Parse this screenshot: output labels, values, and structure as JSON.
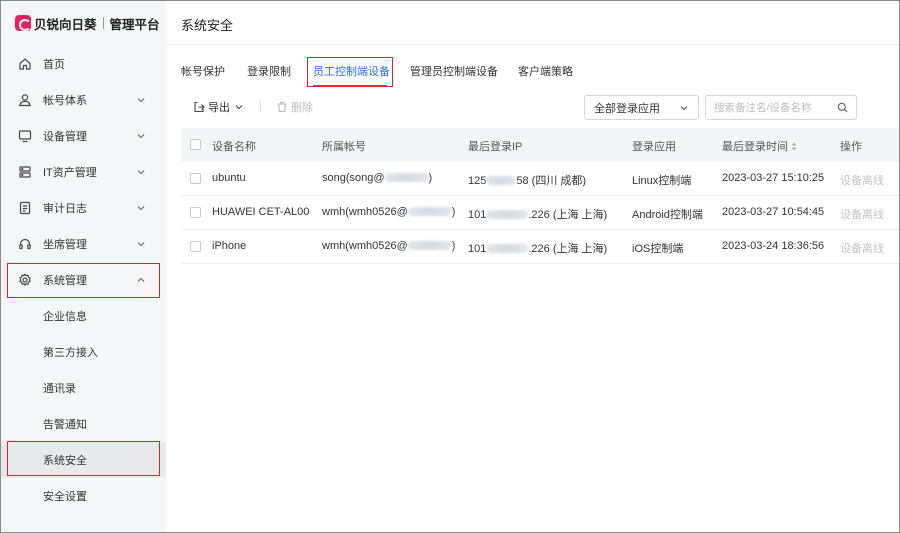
{
  "app": {
    "brand": "贝锐向日葵",
    "product": "管理平台"
  },
  "sidebar": {
    "items": [
      {
        "label": "首页",
        "icon": "home-icon"
      },
      {
        "label": "帐号体系",
        "icon": "user-icon"
      },
      {
        "label": "设备管理",
        "icon": "monitor-icon"
      },
      {
        "label": "IT资产管理",
        "icon": "server-icon"
      },
      {
        "label": "审计日志",
        "icon": "document-icon"
      },
      {
        "label": "坐席管理",
        "icon": "headset-icon"
      },
      {
        "label": "系统管理",
        "icon": "gear-icon",
        "expanded": true
      }
    ],
    "sub_items": [
      {
        "label": "企业信息"
      },
      {
        "label": "第三方接入"
      },
      {
        "label": "通讯录"
      },
      {
        "label": "告警通知"
      },
      {
        "label": "系统安全",
        "selected": true
      },
      {
        "label": "安全设置"
      }
    ]
  },
  "header": {
    "title": "系统安全"
  },
  "tabs": [
    {
      "label": "帐号保护"
    },
    {
      "label": "登录限制"
    },
    {
      "label": "员工控制端设备",
      "active": true
    },
    {
      "label": "管理员控制端设备"
    },
    {
      "label": "客户端策略"
    }
  ],
  "toolbar": {
    "export_label": "导出",
    "delete_label": "删除",
    "app_filter": "全部登录应用",
    "search_placeholder": "搜索备注名/设备名称"
  },
  "table": {
    "columns": [
      "设备名称",
      "所属帐号",
      "最后登录IP",
      "登录应用",
      "最后登录时间",
      "操作"
    ],
    "rows": [
      {
        "device": "ubuntu",
        "account_prefix": "song(song@",
        "account_suffix": ")",
        "ip_prefix": "125",
        "ip_suffix": "58 (四川 成都)",
        "app": "Linux控制端",
        "time": "2023-03-27 15:10:25",
        "action": "设备离线"
      },
      {
        "device": "HUAWEI CET-AL00",
        "account_prefix": "wmh(wmh0526@",
        "account_suffix": ")",
        "ip_prefix": "101",
        "ip_suffix": ".226 (上海 上海)",
        "app": "Android控制端",
        "time": "2023-03-27 10:54:45",
        "action": "设备离线"
      },
      {
        "device": "iPhone",
        "account_prefix": "wmh(wmh0526@",
        "account_suffix": ")",
        "ip_prefix": "101",
        "ip_suffix": ".226 (上海 上海)",
        "app": "iOS控制端",
        "time": "2023-03-24 18:36:56",
        "action": "设备离线"
      }
    ]
  },
  "colors": {
    "accent": "#2e6be6",
    "highlight_border": "#d9252f",
    "brand": "#e8205a",
    "sidebar_bg": "#f5f6f7"
  }
}
